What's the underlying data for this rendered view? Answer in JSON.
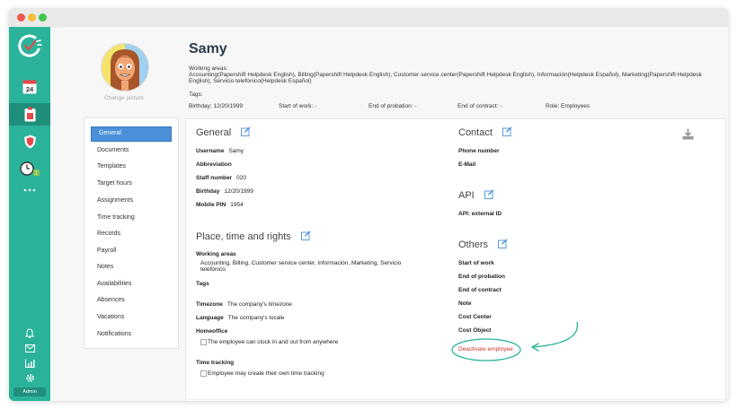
{
  "profile": {
    "name": "Samy",
    "change_picture": "Change picture",
    "working_areas_label": "Working areas:",
    "working_areas_line1": "Accounting(Papershift Helpdesk English), Billing(Papershift Helpdesk English), Customer service center(Papershift Helpdesk English), Información(Helpdesk Español), Marketing(Papershift Helpdesk",
    "working_areas_line2": "English), Servicio telefónico(Helpdesk Español)",
    "tags_label": "Tags:",
    "birthday": "Birthday: 12/20/1999",
    "start_of_work": "Start of work: -",
    "end_of_probation": "End of probation: -",
    "end_of_contract": "End of contract: -",
    "role": "Role: Employees"
  },
  "nav": [
    {
      "label": "General",
      "active": true
    },
    {
      "label": "Documents"
    },
    {
      "label": "Templates"
    },
    {
      "label": "Target hours"
    },
    {
      "label": "Assignments"
    },
    {
      "label": "Time tracking"
    },
    {
      "label": "Records"
    },
    {
      "label": "Payroll"
    },
    {
      "label": "Notes"
    },
    {
      "label": "Availabilities"
    },
    {
      "label": "Absences"
    },
    {
      "label": "Vacations"
    },
    {
      "label": "Notifications"
    }
  ],
  "sidebar": {
    "calendar_day": "24",
    "badge_count": "1",
    "admin_label": "Admin"
  },
  "general": {
    "title": "General",
    "username_label": "Username",
    "username_value": "Samy",
    "abbreviation_label": "Abbreviation",
    "staff_label": "Staff number",
    "staff_value": "020",
    "birthday_label": "Birthday",
    "birthday_value": "12/20/1999",
    "pin_label": "Mobile PIN",
    "pin_value": "1954"
  },
  "place": {
    "title": "Place, time and rights",
    "working_areas_label": "Working areas",
    "working_areas_line1": "Accounting, Billing, Customer service center, Información, Marketing, Servicio",
    "working_areas_line2": "telefónico",
    "tags_label": "Tags",
    "timezone_label": "Timezone",
    "timezone_value": "The company's timezone",
    "language_label": "Language",
    "language_value": "The company's locale",
    "homeoffice_label": "Homeoffice",
    "homeoffice_option": "The employee can clock in and out from anywhere",
    "time_tracking_label": "Time tracking",
    "time_tracking_option": "Employee may create their own time tracking"
  },
  "contact": {
    "title": "Contact",
    "phone_label": "Phone number",
    "email_label": "E-Mail"
  },
  "api": {
    "title": "API",
    "external_id_label": "API: external ID"
  },
  "others": {
    "title": "Others",
    "start_label": "Start of work",
    "probation_label": "End of probation",
    "contract_label": "End of contract",
    "note_label": "Note",
    "cost_center_label": "Cost Center",
    "cost_object_label": "Cost Object",
    "deactivate_label": "Deactivate employee"
  },
  "colors": {
    "sidebar": "#2ab39a",
    "sidebar_active": "#1f8f7b",
    "nav_active": "#4a90d9",
    "deactivate": "#d0342c",
    "annotation": "#2ab39a"
  }
}
